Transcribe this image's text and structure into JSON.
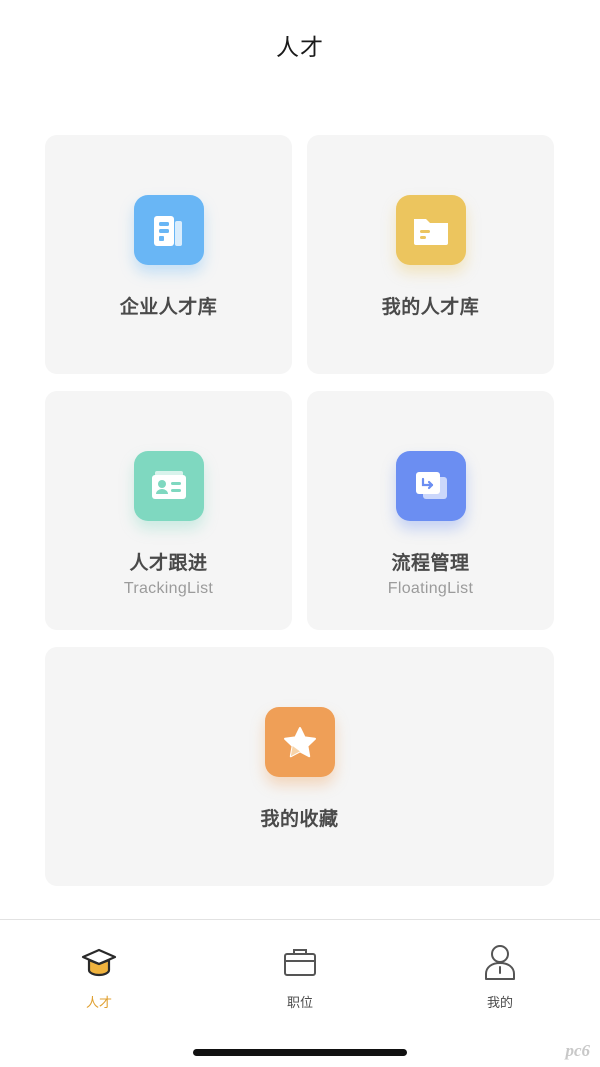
{
  "header": {
    "title": "人才"
  },
  "cards": {
    "enterprise": {
      "title": "企业人才库",
      "icon": "building-icon",
      "color": "#69b6f5"
    },
    "my_talent": {
      "title": "我的人才库",
      "icon": "folder-icon",
      "color": "#ecc55e"
    },
    "tracking": {
      "title": "人才跟进",
      "subtitle": "TrackingList",
      "icon": "id-card-icon",
      "color": "#7fd8c0"
    },
    "process": {
      "title": "流程管理",
      "subtitle": "FloatingList",
      "icon": "flow-document-icon",
      "color": "#6b8ef2"
    },
    "favorites": {
      "title": "我的收藏",
      "icon": "star-icon",
      "color": "#ef9f57"
    }
  },
  "tabbar": {
    "items": [
      {
        "label": "人才",
        "icon": "graduation-cap-icon",
        "active": true
      },
      {
        "label": "职位",
        "icon": "briefcase-icon",
        "active": false
      },
      {
        "label": "我的",
        "icon": "user-icon",
        "active": false
      }
    ],
    "active_color": "#e0a030"
  },
  "watermark": "pc6"
}
